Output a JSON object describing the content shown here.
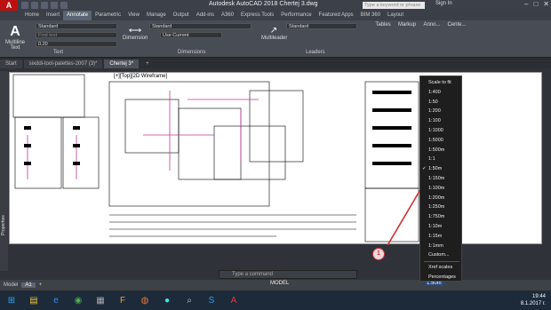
{
  "title_bar": {
    "logo": "A",
    "title": "Autodesk AutoCAD 2018   Chertej 3.dwg",
    "search_placeholder": "Type a keyword or phrase",
    "signin": "Sign In"
  },
  "ribbon_tabs": [
    "Home",
    "Insert",
    "Annotate",
    "Parametric",
    "View",
    "Manage",
    "Output",
    "Add-ins",
    "A360",
    "Express Tools",
    "Performance",
    "Featured Apps",
    "BIM 360",
    "Layout"
  ],
  "ribbon": {
    "text_panel": {
      "big_button": "Multiline Text",
      "style": "Standard",
      "find": "Find text",
      "height": "0.20",
      "title": "Text"
    },
    "dim_panel": {
      "big_button": "Dimension",
      "style": "Standard",
      "layer": "Use Current",
      "title": "Dimensions"
    },
    "leader_panel": {
      "big_button": "Multileader",
      "style": "Standard",
      "title": "Leaders"
    },
    "right_panels": [
      "Tables",
      "Markup",
      "Anno...",
      "Cente..."
    ]
  },
  "doc_tabs": [
    "Start",
    "sixddi-tool-palettes-2007 (3)*",
    "Chertej 3*"
  ],
  "viewport_label": "[+][Top][2D Wireframe]",
  "properties_label": "Properties",
  "command_placeholder": "Type a command",
  "layout_tabs": [
    "Model",
    "A1"
  ],
  "status": {
    "model": "MODEL",
    "scale": "1:50m"
  },
  "scale_menu": {
    "items": [
      "Scale to fit",
      "1:400",
      "1:50",
      "1:200",
      "1:100",
      "1:1000",
      "1:5000",
      "1:500m",
      "1:1",
      "1:50m",
      "1:150m",
      "1:100m",
      "1:200m",
      "1:250m",
      "1:750m",
      "1:10m",
      "1:15m",
      "1:1mm",
      "Custom...",
      "Xref scales",
      "Percentages"
    ],
    "checked": "1:50m"
  },
  "callout_number": "1",
  "clock": {
    "time": "19:44",
    "date": "8.1.2017 г."
  },
  "colors": {
    "ribbon": "#474c55",
    "accent_red": "#cc3344",
    "logo_red": "#bb1111"
  }
}
